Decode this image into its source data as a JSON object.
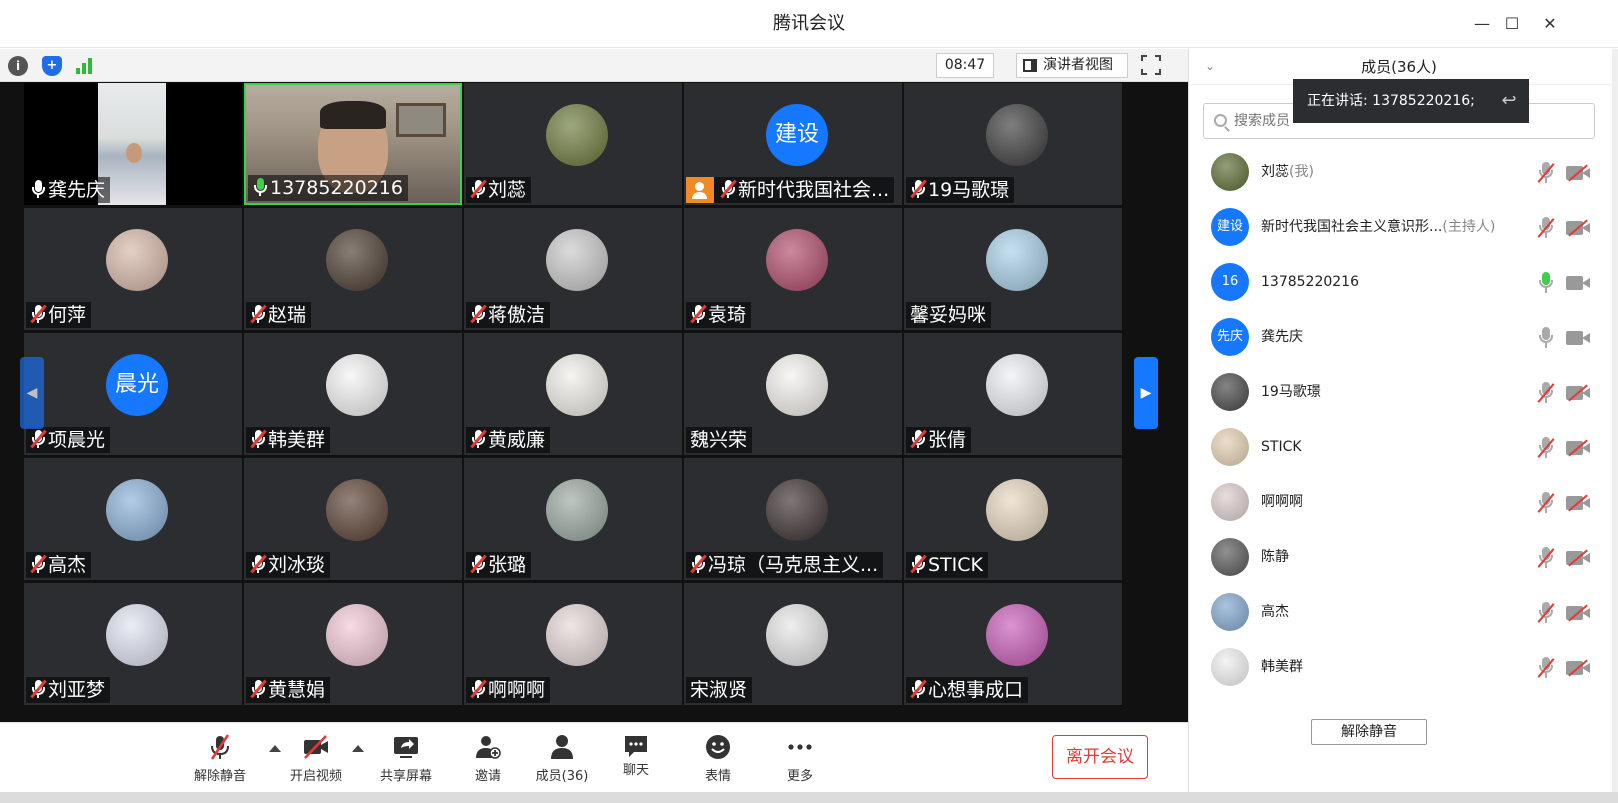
{
  "window": {
    "title": "腾讯会议"
  },
  "topbar": {
    "timer": "08:47",
    "speaker_view": "演讲者视图"
  },
  "tiles": [
    {
      "name": "龚先庆",
      "mic": "on-white",
      "kind": "photo",
      "color": "#8a8a86"
    },
    {
      "name": "13785220216",
      "mic": "green",
      "kind": "photo",
      "color": "#7a6f60"
    },
    {
      "name": "刘蕊",
      "mic": "muted",
      "kind": "avatar",
      "color": "#6b7a3a"
    },
    {
      "name": "新时代我国社会...",
      "mic": "muted",
      "kind": "text-avatar",
      "avatar_text": "建设",
      "color": "#1677ff",
      "host": true
    },
    {
      "name": "19马歌璟",
      "mic": "muted",
      "kind": "avatar",
      "color": "#3a3a3a"
    },
    {
      "name": "何萍",
      "mic": "muted",
      "kind": "avatar",
      "color": "#d8b8a8"
    },
    {
      "name": "赵瑞",
      "mic": "muted",
      "kind": "avatar",
      "color": "#4a3a2e"
    },
    {
      "name": "蒋傲洁",
      "mic": "muted",
      "kind": "avatar",
      "color": "#c9c9c9"
    },
    {
      "name": "袁琦",
      "mic": "muted",
      "kind": "avatar",
      "color": "#b04a6a"
    },
    {
      "name": "馨妥妈咪",
      "mic": "none",
      "kind": "avatar",
      "color": "#a8d0e8"
    },
    {
      "name": "项晨光",
      "mic": "muted",
      "kind": "text-avatar",
      "avatar_text": "晨光",
      "color": "#1677ff"
    },
    {
      "name": "韩美群",
      "mic": "muted",
      "kind": "avatar",
      "color": "#f4f4f4"
    },
    {
      "name": "黄威廉",
      "mic": "muted",
      "kind": "avatar",
      "color": "#f2efe9"
    },
    {
      "name": "魏兴荣",
      "mic": "none",
      "kind": "avatar",
      "color": "#f5f2ee"
    },
    {
      "name": "张倩",
      "mic": "muted",
      "kind": "avatar",
      "color": "#eef0f6"
    },
    {
      "name": "高杰",
      "mic": "muted",
      "kind": "avatar",
      "color": "#8ab0d8"
    },
    {
      "name": "刘冰琰",
      "mic": "muted",
      "kind": "avatar",
      "color": "#5a4032"
    },
    {
      "name": "张璐",
      "mic": "muted",
      "kind": "avatar",
      "color": "#9aa8a0"
    },
    {
      "name": "冯琼（马克思主义...",
      "mic": "muted",
      "kind": "avatar",
      "color": "#3a2e2e"
    },
    {
      "name": "STICK",
      "mic": "muted",
      "kind": "avatar",
      "color": "#e8d8c0"
    },
    {
      "name": "刘亚梦",
      "mic": "muted",
      "kind": "avatar",
      "color": "#dfe4f2"
    },
    {
      "name": "黄慧娟",
      "mic": "muted",
      "kind": "avatar",
      "color": "#f2c8d6"
    },
    {
      "name": "啊啊啊",
      "mic": "muted",
      "kind": "avatar",
      "color": "#e8d8d8"
    },
    {
      "name": "宋淑贤",
      "mic": "none",
      "kind": "avatar",
      "color": "#e6e6e6"
    },
    {
      "name": "心想事成口",
      "mic": "muted",
      "kind": "avatar",
      "color": "#c85ab8"
    }
  ],
  "controls": {
    "unmute": "解除静音",
    "video": "开启视频",
    "share": "共享屏幕",
    "invite": "邀请",
    "members": "成员(36)",
    "chat": "聊天",
    "reactions": "表情",
    "more": "更多",
    "leave": "离开会议"
  },
  "panel": {
    "title": "成员(36人)",
    "search_placeholder": "搜索成员",
    "speaking": "正在讲话: 13785220216;",
    "unmute_all": "解除静音",
    "members": [
      {
        "name": "刘蕊",
        "role": "(我)",
        "avatar_text": "",
        "color": "#5a6a30",
        "mic": "muted",
        "cam": "off"
      },
      {
        "name": "新时代我国社会主义意识形...",
        "role": "(主持人)",
        "avatar_text": "建设",
        "color": "#1677ff",
        "mic": "muted",
        "cam": "off"
      },
      {
        "name": "13785220216",
        "role": "",
        "avatar_text": "16",
        "color": "#1677ff",
        "mic": "on",
        "cam": "plain"
      },
      {
        "name": "龚先庆",
        "role": "",
        "avatar_text": "先庆",
        "color": "#1677ff",
        "mic": "plain",
        "cam": "plain"
      },
      {
        "name": "19马歌璟",
        "role": "",
        "avatar_text": "",
        "color": "#444444",
        "mic": "muted",
        "cam": "off"
      },
      {
        "name": "STICK",
        "role": "",
        "avatar_text": "",
        "color": "#e2cdb0",
        "mic": "muted",
        "cam": "off"
      },
      {
        "name": "啊啊啊",
        "role": "",
        "avatar_text": "",
        "color": "#dccaca",
        "mic": "muted",
        "cam": "off"
      },
      {
        "name": "陈静",
        "role": "",
        "avatar_text": "",
        "color": "#555555",
        "mic": "muted",
        "cam": "off"
      },
      {
        "name": "高杰",
        "role": "",
        "avatar_text": "",
        "color": "#7fa4cc",
        "mic": "muted",
        "cam": "off"
      },
      {
        "name": "韩美群",
        "role": "",
        "avatar_text": "",
        "color": "#eeeeee",
        "mic": "muted",
        "cam": "off"
      }
    ]
  }
}
